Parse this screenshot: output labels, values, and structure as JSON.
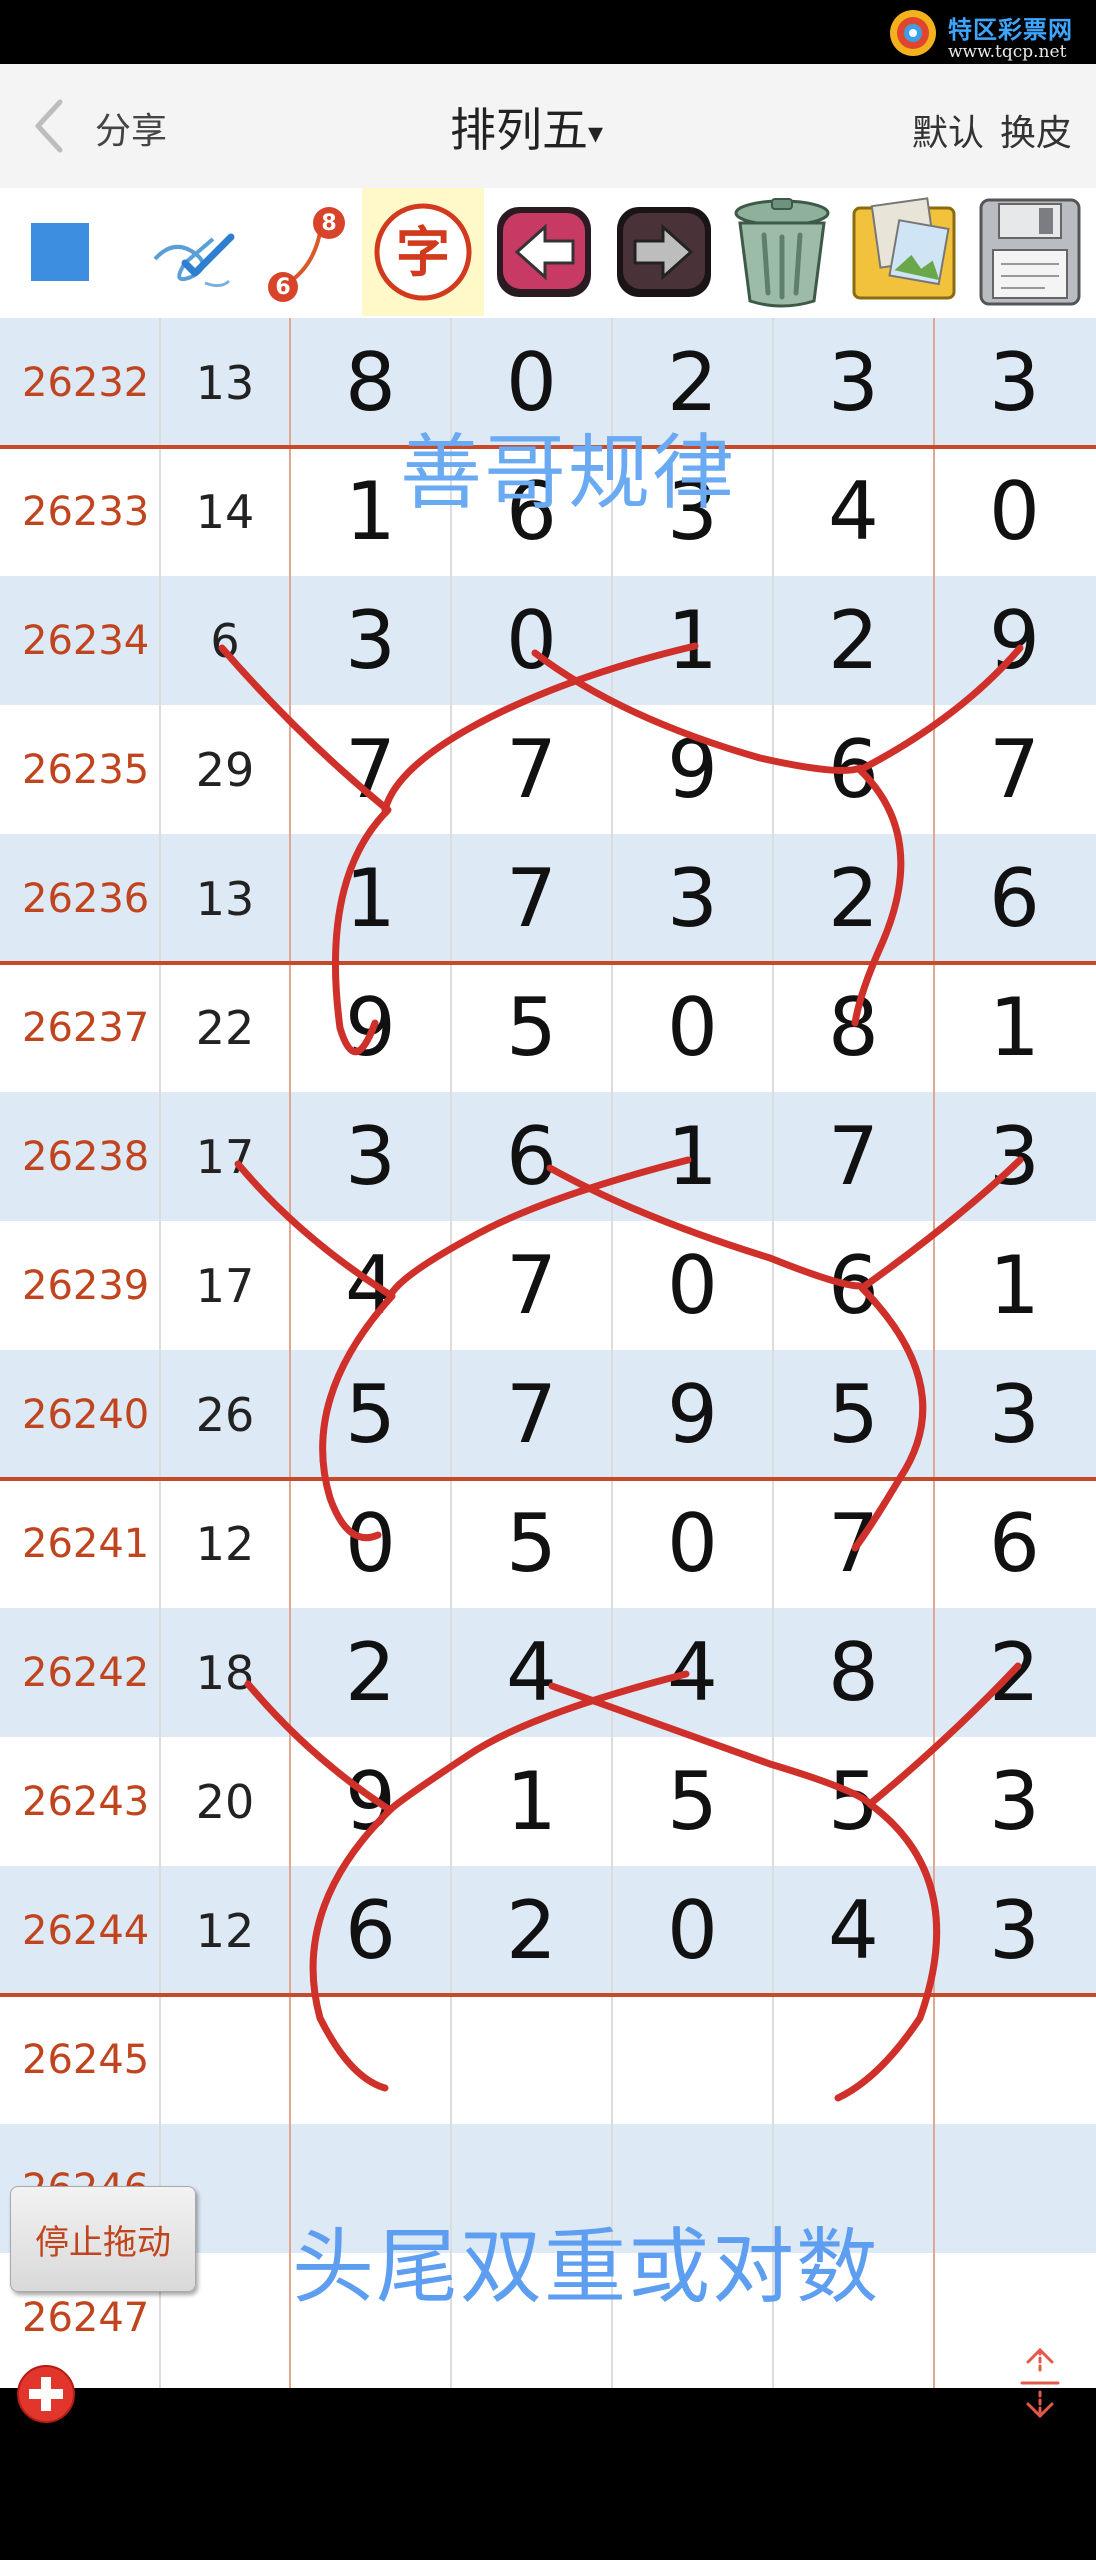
{
  "watermark": {
    "title": "特区彩票网",
    "url": "www.tqcp.net"
  },
  "nav": {
    "share": "分享",
    "title": "排列五",
    "title_caret": "▾",
    "default": "默认",
    "skin": "换皮"
  },
  "toolbar": {
    "tools": [
      "square-color-icon",
      "pen-check-icon",
      "line-numbers-icon",
      "text-icon",
      "undo-icon",
      "redo-icon",
      "trash-icon",
      "photo-album-icon",
      "save-disk-icon"
    ],
    "text_tool_label": "字",
    "line_tool_numbers": [
      "8",
      "6"
    ],
    "accent_color": "#3d8ee0"
  },
  "rows": [
    {
      "issue": "26232",
      "sum": "13",
      "d": [
        "8",
        "0",
        "2",
        "3",
        "3"
      ]
    },
    {
      "issue": "26233",
      "sum": "14",
      "d": [
        "1",
        "6",
        "3",
        "4",
        "0"
      ]
    },
    {
      "issue": "26234",
      "sum": "6",
      "d": [
        "3",
        "0",
        "1",
        "2",
        "9"
      ]
    },
    {
      "issue": "26235",
      "sum": "29",
      "d": [
        "7",
        "7",
        "9",
        "6",
        "7"
      ]
    },
    {
      "issue": "26236",
      "sum": "13",
      "d": [
        "1",
        "7",
        "3",
        "2",
        "6"
      ]
    },
    {
      "issue": "26237",
      "sum": "22",
      "d": [
        "9",
        "5",
        "0",
        "8",
        "1"
      ]
    },
    {
      "issue": "26238",
      "sum": "17",
      "d": [
        "3",
        "6",
        "1",
        "7",
        "3"
      ]
    },
    {
      "issue": "26239",
      "sum": "17",
      "d": [
        "4",
        "7",
        "0",
        "6",
        "1"
      ]
    },
    {
      "issue": "26240",
      "sum": "26",
      "d": [
        "5",
        "7",
        "9",
        "5",
        "3"
      ]
    },
    {
      "issue": "26241",
      "sum": "12",
      "d": [
        "0",
        "5",
        "0",
        "7",
        "6"
      ]
    },
    {
      "issue": "26242",
      "sum": "18",
      "d": [
        "2",
        "4",
        "4",
        "8",
        "2"
      ]
    },
    {
      "issue": "26243",
      "sum": "20",
      "d": [
        "9",
        "1",
        "5",
        "5",
        "3"
      ]
    },
    {
      "issue": "26244",
      "sum": "12",
      "d": [
        "6",
        "2",
        "0",
        "4",
        "3"
      ]
    },
    {
      "issue": "26245",
      "sum": "",
      "d": [
        "",
        "",
        "",
        "",
        ""
      ]
    },
    {
      "issue": "26246",
      "sum": "",
      "d": [
        "",
        "",
        "",
        "",
        ""
      ]
    },
    {
      "issue": "26247",
      "sum": "",
      "d": [
        "",
        "",
        "",
        "",
        ""
      ]
    }
  ],
  "annotations": {
    "top_label": "善哥规律",
    "bottom_label": "头尾双重或对数",
    "stroke_color": "#d0302a"
  },
  "stop_drag": "停止拖动",
  "colors": {
    "row_alt": "#dde9f5",
    "issue_text": "#c0441d",
    "separator": "#c64a2a",
    "label_blue": "#5e9ef0"
  }
}
